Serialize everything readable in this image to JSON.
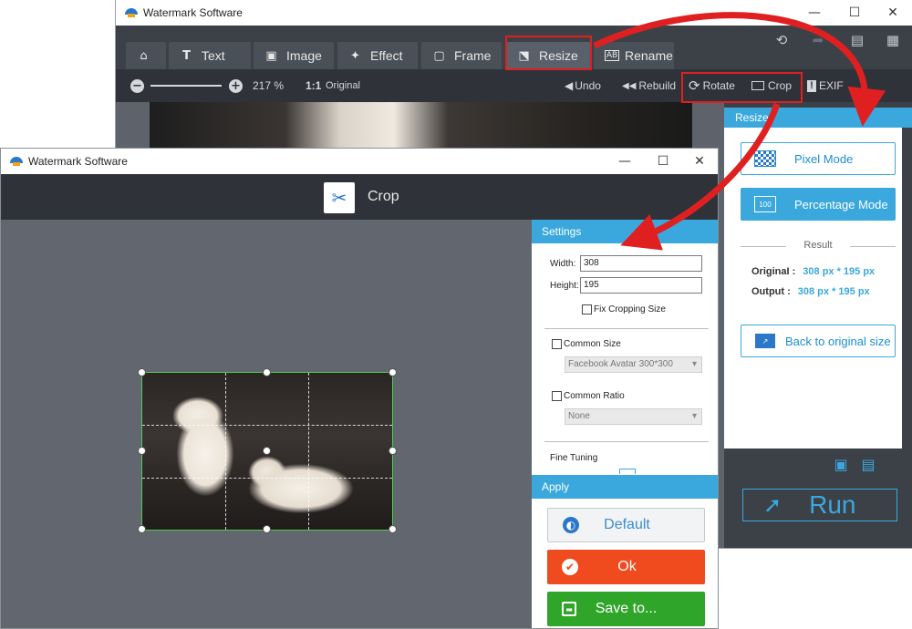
{
  "main_window": {
    "title": "Watermark Software",
    "controls": {
      "minimize": "—",
      "maximize": "☐",
      "close": "✕"
    },
    "tabs": [
      {
        "label": "",
        "icon": "home-icon"
      },
      {
        "label": "Text",
        "icon": "text-icon"
      },
      {
        "label": "Image",
        "icon": "image-icon"
      },
      {
        "label": "Effect",
        "icon": "effect-icon"
      },
      {
        "label": "Frame",
        "icon": "frame-icon"
      },
      {
        "label": "Resize",
        "icon": "resize-icon",
        "active": true
      },
      {
        "label": "Rename",
        "icon": "rename-icon"
      }
    ],
    "toolbar": {
      "zoom_value": "217 %",
      "original_icon": "1:1",
      "original_label": "Original",
      "undo_label": "Undo",
      "rebuild_label": "Rebuild",
      "rotate_label": "Rotate",
      "crop_label": "Crop",
      "exif_label": "EXIF"
    },
    "resize_panel": {
      "header": "Resize",
      "pixel_mode": "Pixel Mode",
      "percentage_mode": "Percentage Mode",
      "result_title": "Result",
      "original_label": "OriginaI :",
      "original_value": "308 px * 195 px",
      "output_label": "Output :",
      "output_value": "308 px * 195 px",
      "back_to_original": "Back to original size",
      "run_label": "Run"
    }
  },
  "crop_window": {
    "title": "Watermark Software",
    "controls": {
      "minimize": "—",
      "maximize": "☐",
      "close": "✕"
    },
    "header_title": "Crop",
    "settings": {
      "header": "Settings",
      "width_label": "Width:",
      "width_value": "308",
      "height_label": "Height:",
      "height_value": "195",
      "fix_cropping_label": "Fix Cropping Size",
      "common_size_label": "Common Size",
      "common_size_value": "Facebook Avatar 300*300",
      "common_ratio_label": "Common Ratio",
      "common_ratio_value": "None",
      "fine_tuning_label": "Fine Tuning"
    },
    "apply": {
      "header": "Apply",
      "default_label": "Default",
      "ok_label": "Ok",
      "save_label": "Save to..."
    }
  },
  "colors": {
    "accent": "#3aa8dd",
    "highlight_red": "#e02020",
    "ok_orange": "#f04a1f",
    "save_green": "#2fa52a"
  }
}
